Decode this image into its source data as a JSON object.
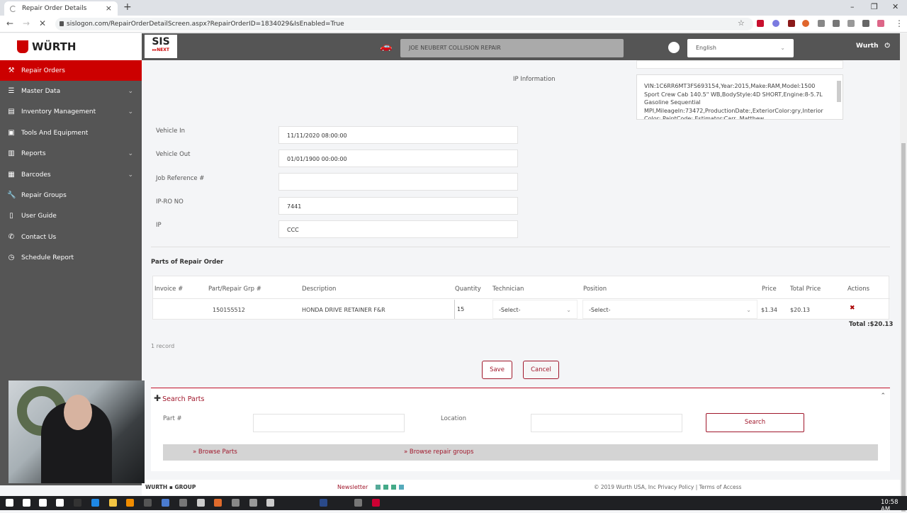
{
  "browser": {
    "tab_title": "Repair Order Details",
    "tab_close": "×",
    "new_tab": "+",
    "url": "sislogon.com/RepairOrderDetailScreen.aspx?RepairOrderID=1834029&IsEnabled=True",
    "nav": {
      "back": "←",
      "forward": "→",
      "stop": "✕"
    },
    "window": {
      "minimize": "–",
      "restore": "❐",
      "close": "✕"
    },
    "bookmark": "☆",
    "menu": "⋮"
  },
  "header": {
    "brand": "WÜRTH",
    "sis_logo": "SIS",
    "sis_sub": "▸▸NEXT",
    "car_icon": "🚗",
    "shop_name": "JOE NEUBERT COLLISION REPAIR",
    "language": "English",
    "user": "Wurth",
    "power_icon": "⏻"
  },
  "sidebar": {
    "items": [
      {
        "label": "Repair Orders",
        "icon": "gavel-icon",
        "glyph": "⚒",
        "active": true,
        "expandable": false
      },
      {
        "label": "Master Data",
        "icon": "database-icon",
        "glyph": "☰",
        "active": false,
        "expandable": true
      },
      {
        "label": "Inventory Management",
        "icon": "list-icon",
        "glyph": "▤",
        "active": false,
        "expandable": true
      },
      {
        "label": "Tools And Equipment",
        "icon": "toolbox-icon",
        "glyph": "▣",
        "active": false,
        "expandable": false
      },
      {
        "label": "Reports",
        "icon": "bar-chart-icon",
        "glyph": "▥",
        "active": false,
        "expandable": true
      },
      {
        "label": "Barcodes",
        "icon": "barcode-icon",
        "glyph": "▦",
        "active": false,
        "expandable": true
      },
      {
        "label": "Repair Groups",
        "icon": "wrench-icon",
        "glyph": "🔧",
        "active": false,
        "expandable": false
      },
      {
        "label": "User Guide",
        "icon": "book-icon",
        "glyph": "▯",
        "active": false,
        "expandable": false
      },
      {
        "label": "Contact Us",
        "icon": "phone-icon",
        "glyph": "✆",
        "active": false,
        "expandable": false
      },
      {
        "label": "Schedule Report",
        "icon": "clock-icon",
        "glyph": "◷",
        "active": false,
        "expandable": false
      }
    ],
    "chevron": "⌄"
  },
  "form": {
    "ip_info_label": "IP Information",
    "ip_info_value": "VIN:1C6RR6MT3FS693154,Year:2015,Make:RAM,Model:1500 Sport Crew Cab 140.5\" WB,BodyStyle:4D SHORT,Engine:8-5.7L Gasoline Sequential MPI,MileageIn:73472,ProductionDate:,ExteriorColor:gry,Interior Color:,PaintCode:,Estimator:Carr, Matthew",
    "fields": [
      {
        "label": "Vehicle In",
        "value": "11/11/2020 08:00:00"
      },
      {
        "label": "Vehicle Out",
        "value": "01/01/1900 00:00:00"
      },
      {
        "label": "Job Reference #",
        "value": ""
      },
      {
        "label": "IP-RO NO",
        "value": "7441"
      },
      {
        "label": "IP",
        "value": "CCC"
      }
    ]
  },
  "parts": {
    "title": "Parts of Repair Order",
    "columns": [
      "Invoice #",
      "Part/Repair Grp #",
      "Description",
      "Quantity",
      "Technician",
      "Position",
      "Price",
      "Total Price",
      "Actions"
    ],
    "rows": [
      {
        "invoice": "",
        "part": "150155512",
        "description": "HONDA DRIVE RETAINER F&R",
        "quantity": "15",
        "technician": "-Select-",
        "position": "-Select-",
        "price": "$1.34",
        "total_price": "$20.13",
        "delete_icon": "✖"
      }
    ],
    "total": "Total :$20.13",
    "records": "1 record",
    "save": "Save",
    "cancel": "Cancel"
  },
  "search_parts": {
    "title": "Search Parts",
    "plus": "✚",
    "collapse": "⌃",
    "part_label": "Part #",
    "part_value": "",
    "location_label": "Location",
    "location_value": "",
    "search_button": "Search",
    "browse_parts": "» Browse Parts",
    "browse_groups": "» Browse repair groups"
  },
  "footer": {
    "group": "WURTH ▪ GROUP",
    "newsletter": "Newsletter",
    "copyright": "© 2019 Wurth USA, Inc",
    "privacy": "Privacy Policy",
    "sep": "|",
    "terms": "Terms of Access"
  },
  "taskbar": {
    "time": "10:58 AM"
  }
}
